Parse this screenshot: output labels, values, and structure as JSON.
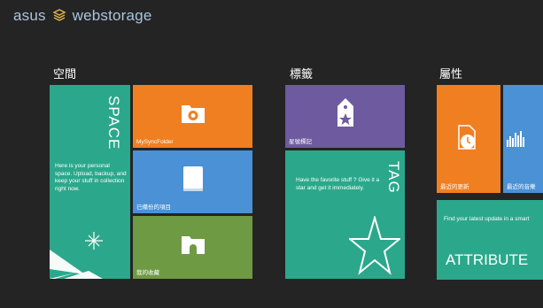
{
  "app": {
    "logo_text_left": "asus",
    "logo_text_right": "webstorage",
    "brand_color": "#a9c4df"
  },
  "sections": {
    "space": {
      "title": "空間"
    },
    "tags": {
      "title": "標籤"
    },
    "attributes": {
      "title": "屬性"
    }
  },
  "tiles": {
    "space": {
      "heading": "SPACE",
      "description": "Here is your personal space. Upload, backup, and keep your stuff in collection right now.",
      "color": "#2ba88b"
    },
    "mysyncfolder": {
      "label": "MySyncFolder",
      "icon": "sync-folder-icon",
      "color": "#f07f21"
    },
    "backup": {
      "label": "已備份的項目",
      "icon": "backup-drive-icon",
      "color": "#4a91d6"
    },
    "collection": {
      "label": "我的收藏",
      "icon": "collection-folder-icon",
      "color": "#6e9a44"
    },
    "starred": {
      "label": "星號標記",
      "icon": "star-tag-icon",
      "color": "#6d5a9f"
    },
    "tag": {
      "heading": "TAG",
      "description": "Have the favorite stuff ? Give it a star and get it immediately.",
      "color": "#2ba88b"
    },
    "recent_updates": {
      "label": "最近的更新",
      "icon": "recent-update-icon",
      "color": "#f07f21"
    },
    "recent_music": {
      "label": "最近的音樂",
      "icon": "music-bars-icon",
      "color": "#4a91d6"
    },
    "attribute": {
      "heading": "ATTRIBUTE",
      "description": "Find your latest update in a smart",
      "color": "#2ba88b"
    }
  }
}
